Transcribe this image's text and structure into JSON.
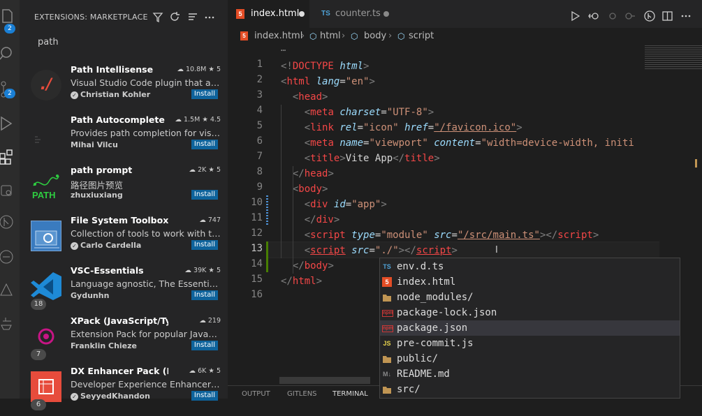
{
  "activity_bar": {
    "explorer_badge": "2",
    "scm_badge": "2",
    "icons": [
      "files-icon",
      "search-icon",
      "source-control-icon",
      "run-debug-icon",
      "extensions-icon",
      "remote-explorer-icon",
      "git-graph-icon",
      "docker-icon",
      "warning-icon",
      "testing-icon"
    ]
  },
  "sidebar": {
    "title": "EXTENSIONS: MARKETPLACE",
    "search_value": "path",
    "install_label": "Install",
    "extensions": [
      {
        "name": "Path Intellisense",
        "downloads": "10.8M",
        "rating": "5",
        "description": "Visual Studio Code plugin that auto...",
        "author": "Christian Kohler",
        "verified": true,
        "logo_color": "#2b2b2b",
        "logo_text": "./",
        "count": ""
      },
      {
        "name": "Path Autocomplete",
        "downloads": "1.5M",
        "rating": "4.5",
        "description": "Provides path completion for visual...",
        "author": "Mihai Vilcu",
        "verified": false,
        "logo_color": "#252526",
        "logo_text": "",
        "count": ""
      },
      {
        "name": "path prompt",
        "downloads": "2K",
        "rating": "5",
        "description": "路径图片预览",
        "author": "zhuxiuxiang",
        "verified": false,
        "logo_color": "#252526",
        "logo_text": "PATH",
        "count": ""
      },
      {
        "name": "File System Toolbox",
        "downloads": "747",
        "rating": "",
        "description": "Collection of tools to work with the ...",
        "author": "Carlo Cardella",
        "verified": true,
        "logo_color": "#3a7bbf",
        "logo_text": "",
        "count": ""
      },
      {
        "name": "VSC-Essentials",
        "downloads": "39K",
        "rating": "5",
        "description": "Language agnostic, The Essential ex...",
        "author": "Gydunhn",
        "verified": false,
        "logo_color": "#1e8ad6",
        "logo_text": "",
        "count": "18"
      },
      {
        "name": "XPack (JavaScript/TypeSc...",
        "downloads": "219",
        "rating": "",
        "description": "Extension Pack for popular JavaScri...",
        "author": "Franklin Chieze",
        "verified": false,
        "logo_color": "#252526",
        "logo_text": "",
        "count": "7"
      },
      {
        "name": "DX Enhancer Pack (EPa...",
        "downloads": "6K",
        "rating": "5",
        "description": "Developer Experience Enhancer/Ma...",
        "author": "SeyyedKhandon",
        "verified": true,
        "logo_color": "#e74c3c",
        "logo_text": "",
        "count": "6"
      }
    ]
  },
  "tabs": [
    {
      "label": "index.html",
      "dirty": true,
      "active": true,
      "icon": "html5-icon"
    },
    {
      "label": "counter.ts",
      "dirty": true,
      "active": false,
      "icon": "ts-icon"
    }
  ],
  "breadcrumb": [
    "index.html",
    "html",
    "body",
    "script"
  ],
  "line_numbers": [
    "1",
    "2",
    "3",
    "4",
    "5",
    "6",
    "7",
    "8",
    "9",
    "10",
    "11",
    "12",
    "13",
    "14",
    "15",
    "16"
  ],
  "current_line": "13",
  "code_fold_indicator": "…",
  "code_lines": [
    [
      [
        "p",
        "<!"
      ],
      [
        "ht",
        "DOCTYPE"
      ],
      [
        "tx",
        " "
      ],
      [
        "a",
        "html"
      ],
      [
        "p",
        ">"
      ]
    ],
    [
      [
        "p",
        "<"
      ],
      [
        "ht",
        "html"
      ],
      [
        "tx",
        " "
      ],
      [
        "a",
        "lang"
      ],
      [
        "tx",
        "="
      ],
      [
        "s",
        "\"en\""
      ],
      [
        "p",
        ">"
      ]
    ],
    [
      [
        "tx",
        "  "
      ],
      [
        "p",
        "<"
      ],
      [
        "ht",
        "head"
      ],
      [
        "p",
        ">"
      ]
    ],
    [
      [
        "tx",
        "    "
      ],
      [
        "p",
        "<"
      ],
      [
        "ht",
        "meta"
      ],
      [
        "tx",
        " "
      ],
      [
        "a",
        "charset"
      ],
      [
        "tx",
        "="
      ],
      [
        "s",
        "\"UTF-8\""
      ],
      [
        "p",
        ">"
      ]
    ],
    [
      [
        "tx",
        "    "
      ],
      [
        "p",
        "<"
      ],
      [
        "ht",
        "link"
      ],
      [
        "tx",
        " "
      ],
      [
        "a",
        "rel"
      ],
      [
        "tx",
        "="
      ],
      [
        "s",
        "\"icon\""
      ],
      [
        "tx",
        " "
      ],
      [
        "a",
        "href"
      ],
      [
        "tx",
        "="
      ],
      [
        "s",
        "\"/favicon.ico\""
      ],
      [
        "p",
        ">"
      ]
    ],
    [
      [
        "tx",
        "    "
      ],
      [
        "p",
        "<"
      ],
      [
        "ht",
        "meta"
      ],
      [
        "tx",
        " "
      ],
      [
        "a",
        "name"
      ],
      [
        "tx",
        "="
      ],
      [
        "s",
        "\"viewport\""
      ],
      [
        "tx",
        " "
      ],
      [
        "a",
        "content"
      ],
      [
        "tx",
        "="
      ],
      [
        "s",
        "\"width=device-width, initi"
      ]
    ],
    [
      [
        "tx",
        "    "
      ],
      [
        "p",
        "<"
      ],
      [
        "ht",
        "title"
      ],
      [
        "p",
        ">"
      ],
      [
        "tx",
        "Vite App"
      ],
      [
        "p",
        "</"
      ],
      [
        "ht",
        "title"
      ],
      [
        "p",
        ">"
      ]
    ],
    [
      [
        "tx",
        "  "
      ],
      [
        "p",
        "</"
      ],
      [
        "ht",
        "head"
      ],
      [
        "p",
        ">"
      ]
    ],
    [
      [
        "tx",
        "  "
      ],
      [
        "p",
        "<"
      ],
      [
        "ht",
        "body"
      ],
      [
        "p",
        ">"
      ]
    ],
    [
      [
        "tx",
        "    "
      ],
      [
        "p",
        "<"
      ],
      [
        "ht",
        "div"
      ],
      [
        "tx",
        " "
      ],
      [
        "a",
        "id"
      ],
      [
        "tx",
        "="
      ],
      [
        "s",
        "\"app\""
      ],
      [
        "p",
        ">"
      ]
    ],
    [
      [
        "tx",
        "    "
      ],
      [
        "p",
        "</"
      ],
      [
        "ht",
        "div"
      ],
      [
        "p",
        ">"
      ]
    ],
    [
      [
        "tx",
        "    "
      ],
      [
        "p",
        "<"
      ],
      [
        "ht",
        "script"
      ],
      [
        "tx",
        " "
      ],
      [
        "a",
        "type"
      ],
      [
        "tx",
        "="
      ],
      [
        "s",
        "\"module\""
      ],
      [
        "tx",
        " "
      ],
      [
        "a",
        "src"
      ],
      [
        "tx",
        "="
      ],
      [
        "s",
        "\"/src/main.ts\""
      ],
      [
        "p",
        "></"
      ],
      [
        "ht",
        "script"
      ],
      [
        "p",
        ">"
      ]
    ],
    [
      [
        "tx",
        "    "
      ],
      [
        "p",
        "<"
      ],
      [
        "ht",
        "script"
      ],
      [
        "tx",
        " "
      ],
      [
        "a",
        "src"
      ],
      [
        "tx",
        "="
      ],
      [
        "s",
        "\"./\""
      ],
      [
        "p",
        "></"
      ],
      [
        "ht",
        "script"
      ],
      [
        "p",
        ">"
      ]
    ],
    [
      [
        "tx",
        "  "
      ],
      [
        "p",
        "</"
      ],
      [
        "ht",
        "body"
      ],
      [
        "p",
        ">"
      ]
    ],
    [
      [
        "p",
        "</"
      ],
      [
        "ht",
        "html"
      ],
      [
        "p",
        ">"
      ]
    ],
    []
  ],
  "suggestions": [
    {
      "label": "env.d.ts",
      "kind": "ts",
      "icon_text": "TS",
      "color": "#4fa3d8"
    },
    {
      "label": "index.html",
      "kind": "html",
      "icon_text": "5",
      "color": "#e44d26"
    },
    {
      "label": "node_modules/",
      "kind": "folder",
      "icon_text": "",
      "color": "#c09553"
    },
    {
      "label": "package-lock.json",
      "kind": "npm",
      "icon_text": "npm",
      "color": "#cb3837"
    },
    {
      "label": "package.json",
      "kind": "npm",
      "icon_text": "npm",
      "color": "#cb3837",
      "selected": true
    },
    {
      "label": "pre-commit.js",
      "kind": "js",
      "icon_text": "JS",
      "color": "#e8d44d"
    },
    {
      "label": "public/",
      "kind": "folder",
      "icon_text": "",
      "color": "#c09553"
    },
    {
      "label": "README.md",
      "kind": "md",
      "icon_text": "M↓",
      "color": "#888"
    },
    {
      "label": "src/",
      "kind": "folder",
      "icon_text": "",
      "color": "#c09553"
    }
  ],
  "panel_tabs": [
    "OUTPUT",
    "GITLENS",
    "TERMINAL"
  ]
}
